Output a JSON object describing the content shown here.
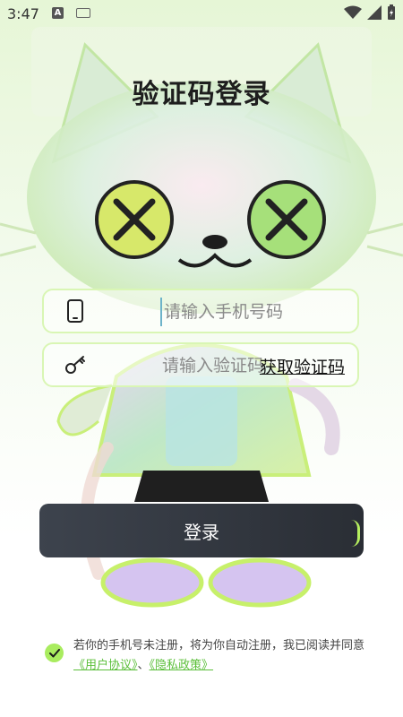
{
  "status_bar": {
    "time": "3:47",
    "notif_letter": "A"
  },
  "page": {
    "title": "验证码登录"
  },
  "phone_field": {
    "placeholder": "请输入手机号码"
  },
  "code_field": {
    "placeholder": "请输入验证码",
    "get_code_label": "获取验证码"
  },
  "login": {
    "label": "登录"
  },
  "agreement": {
    "text": "若你的手机号未注册，将为你自动注册，我已阅读并同意",
    "user_agreement": "《用户协议》",
    "separator": "、",
    "privacy_policy": "《隐私政策》"
  },
  "colors": {
    "accent": "#a9ec5f",
    "link": "#5bbf3a",
    "button": "#2f333a"
  }
}
